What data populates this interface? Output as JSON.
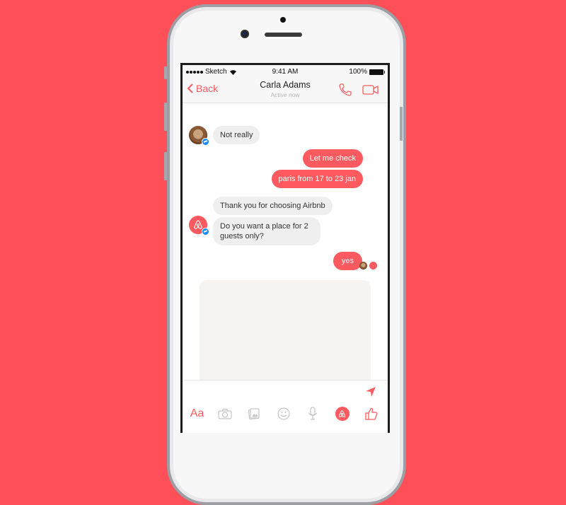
{
  "colors": {
    "background": "#ff4f58",
    "accent": "#ff5a5f",
    "incoming_bubble": "#efefef",
    "messenger_badge": "#1a8cff"
  },
  "status_bar": {
    "carrier": "Sketch",
    "time": "9:41 AM",
    "battery": "100%"
  },
  "header": {
    "back_label": "Back",
    "contact_name": "Carla Adams",
    "presence": "Active now",
    "icons": [
      "phone-icon",
      "video-camera-icon"
    ]
  },
  "conversation": {
    "messages": [
      {
        "from": "Carla Adams",
        "direction": "incoming",
        "text": "Not really"
      },
      {
        "from": "me",
        "direction": "outgoing",
        "text": "Let me check"
      },
      {
        "from": "me",
        "direction": "outgoing",
        "text": "paris from 17 to 23 jan"
      },
      {
        "from": "Airbnb",
        "direction": "incoming",
        "text": "Thank you for choosing Airbnb"
      },
      {
        "from": "Airbnb",
        "direction": "incoming",
        "text": "Do you want a place for 2 guests only?"
      },
      {
        "from": "me",
        "direction": "outgoing",
        "text": "yes"
      }
    ]
  },
  "composer": {
    "send_icon": "send-arrow-icon",
    "toolbar": [
      {
        "name": "text-format",
        "label": "Aa"
      },
      {
        "name": "camera",
        "icon": "camera-icon"
      },
      {
        "name": "gallery",
        "icon": "photo-gallery-icon"
      },
      {
        "name": "emoji",
        "icon": "smiley-icon"
      },
      {
        "name": "voice",
        "icon": "microphone-icon"
      },
      {
        "name": "airbnb-app",
        "icon": "airbnb-logo-icon"
      },
      {
        "name": "like",
        "icon": "thumbs-up-icon"
      }
    ]
  }
}
